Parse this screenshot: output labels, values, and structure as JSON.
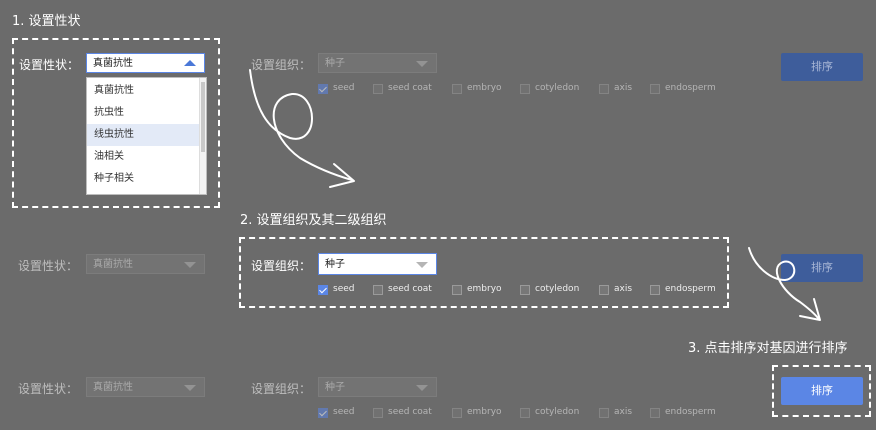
{
  "steps": {
    "step1": "1. 设置性状",
    "step2": "2. 设置组织及其二级组织",
    "step3": "3. 点击排序对基因进行排序"
  },
  "labels": {
    "trait": "设置性状：",
    "tissue": "设置组织："
  },
  "trait_selected": "真菌抗性",
  "trait_options": [
    "真菌抗性",
    "抗虫性",
    "线虫抗性",
    "油相关",
    "种子相关"
  ],
  "tissue_selected": "种子",
  "subtissues": [
    "seed",
    "seed coat",
    "embryo",
    "cotyledon",
    "axis",
    "endosperm"
  ],
  "sort_button": "排序",
  "colors": {
    "accent": "#5b86e5",
    "background": "#6b6b6b"
  }
}
